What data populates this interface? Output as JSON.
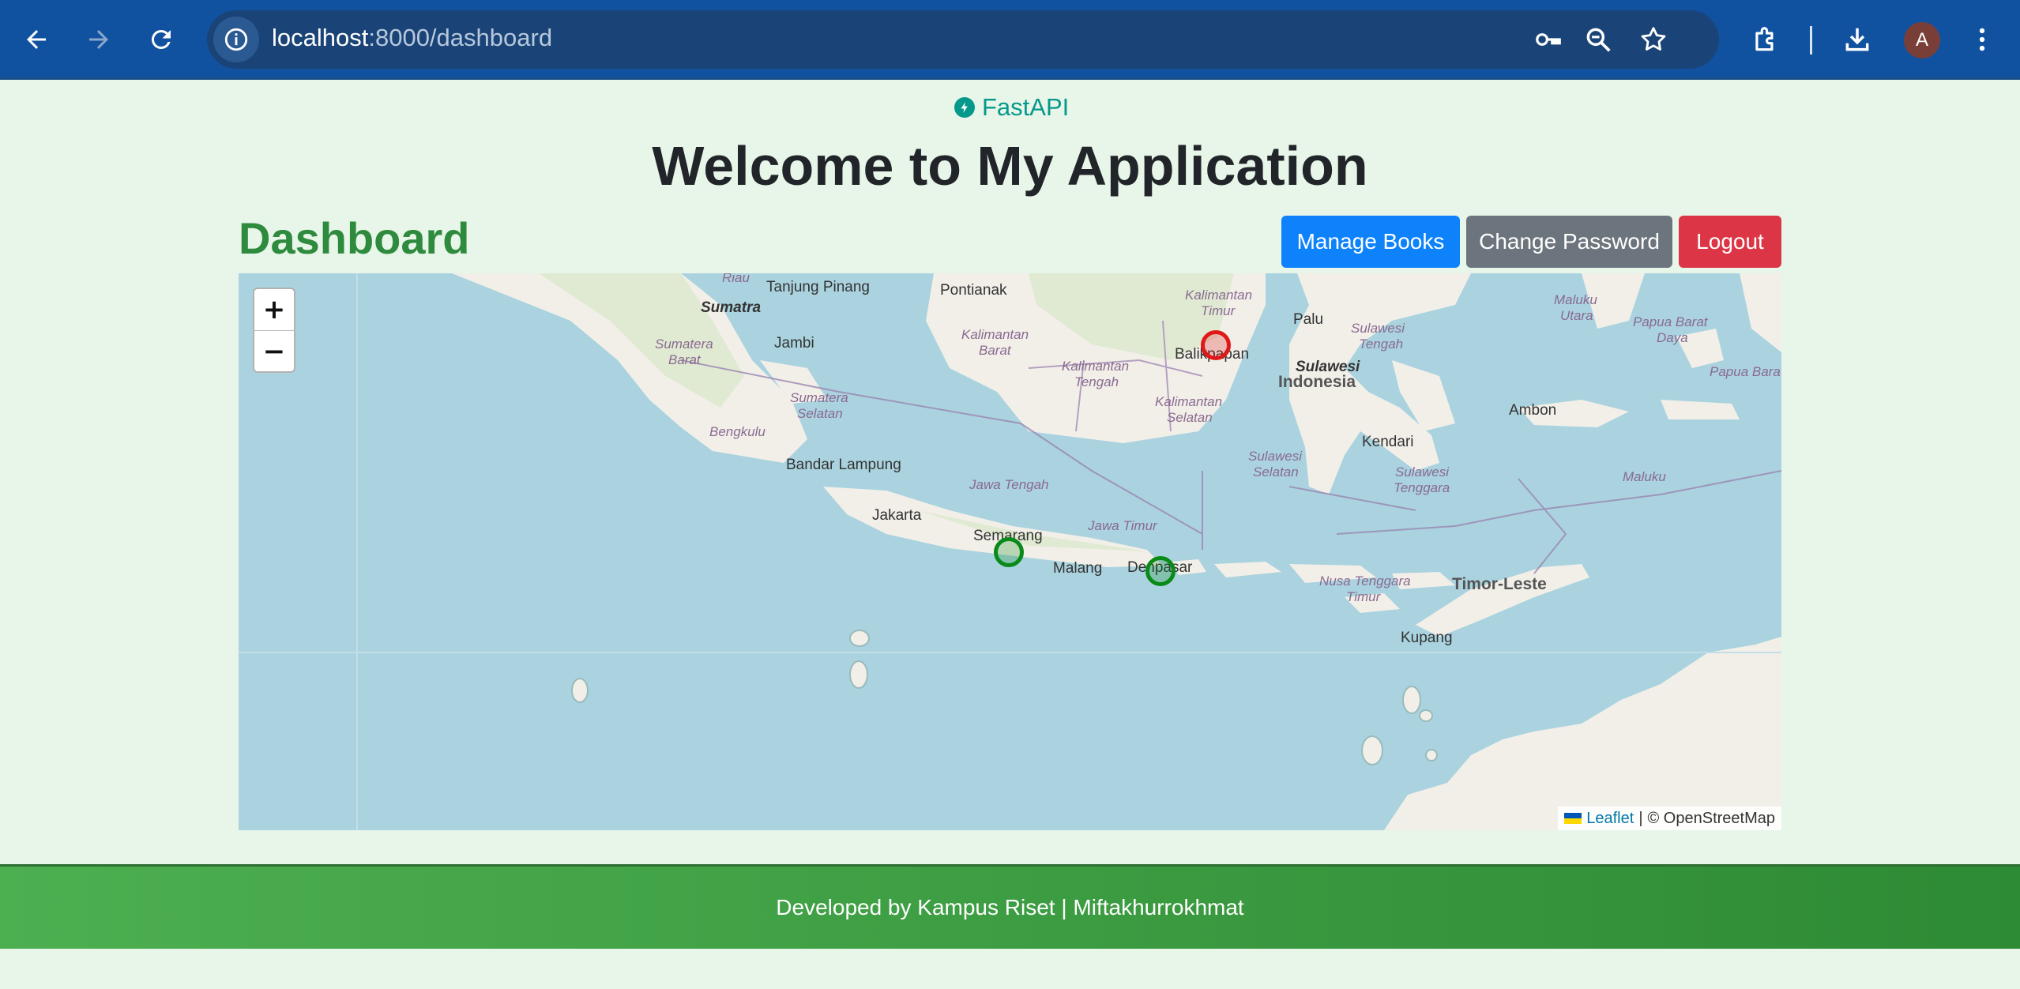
{
  "browser": {
    "url_host": "localhost",
    "url_path": ":8000/dashboard",
    "profile_initial": "A"
  },
  "brand": {
    "text": "FastAPI"
  },
  "page": {
    "title": "Welcome to My Application",
    "dashboard_title": "Dashboard"
  },
  "buttons": {
    "manage_books": "Manage Books",
    "change_password": "Change Password",
    "logout": "Logout"
  },
  "map": {
    "zoom_in": "+",
    "zoom_out": "−",
    "attribution_leaflet": "Leaflet",
    "attribution_sep": "|",
    "attribution_osm": "© OpenStreetMap",
    "colors": {
      "sea": "#aad3df",
      "land": "#f2efe9",
      "marker_green": "#0a8a18",
      "marker_red": "#e01818"
    },
    "markers": [
      {
        "color": "red"
      },
      {
        "color": "green"
      },
      {
        "color": "green"
      }
    ],
    "labels": {
      "tanjung_pinang": "Tanjung Pinang",
      "pontianak": "Pontianak",
      "sumatra": "Sumatra",
      "riau": "Riau",
      "jambi": "Jambi",
      "sumatera_barat_1": "Sumatera",
      "sumatera_barat_2": "Barat",
      "sumatera_selatan_1": "Sumatera",
      "sumatera_selatan_2": "Selatan",
      "bengkulu": "Bengkulu",
      "bandar_lampung": "Bandar Lampung",
      "jakarta": "Jakarta",
      "kalbar_1": "Kalimantan",
      "kalbar_2": "Barat",
      "kalteng_1": "Kalimantan",
      "kalteng_2": "Tengah",
      "kaltim_1": "Kalimantan",
      "kaltim_2": "Timur",
      "kalsel_1": "Kalimantan",
      "kalsel_2": "Selatan",
      "balikpapan": "Balikpapan",
      "palu": "Palu",
      "sulteng_1": "Sulawesi",
      "sulteng_2": "Tengah",
      "sulawesi": "Sulawesi",
      "indonesia": "Indonesia",
      "sulsel_1": "Sulawesi",
      "sulsel_2": "Selatan",
      "sultra_1": "Sulawesi",
      "sultra_2": "Tenggara",
      "kendari": "Kendari",
      "ambon": "Ambon",
      "maluku": "Maluku",
      "malut_1": "Maluku",
      "malut_2": "Utara",
      "papua_bd_1": "Papua Barat",
      "papua_bd_2": "Daya",
      "papua_barat": "Papua Bara",
      "jawa_tengah": "Jawa Tengah",
      "jawa_timur": "Jawa Timur",
      "semarang": "Semarang",
      "malang": "Malang",
      "denpasar": "Denpasar",
      "ntt_1": "Nusa Tenggara",
      "ntt_2": "Timur",
      "timor_leste": "Timor-Leste",
      "kupang": "Kupang"
    }
  },
  "footer": {
    "text": "Developed by Kampus Riset | Miftakhurrokhmat"
  }
}
